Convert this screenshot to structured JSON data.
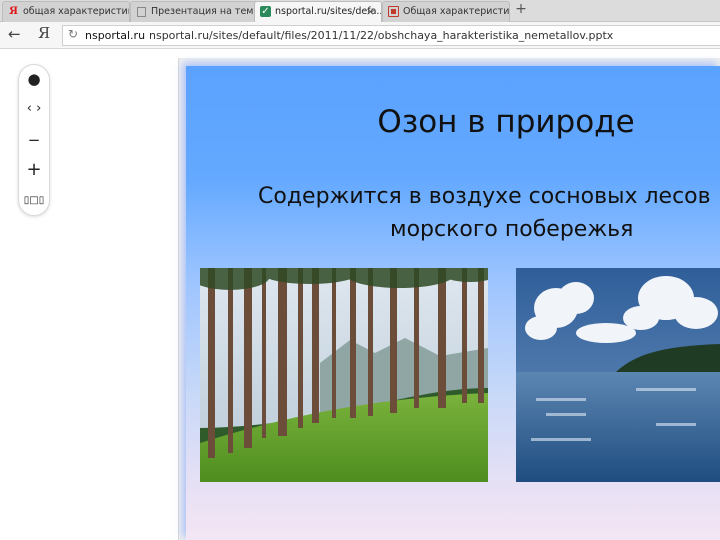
{
  "tabs": [
    {
      "label": "общая характеристика",
      "icon": "yandex-icon",
      "active": false
    },
    {
      "label": "Презентация на тему",
      "icon": "page-icon",
      "active": false
    },
    {
      "label": "nsportal.ru/sites/defa...",
      "icon": "nsportal-check-icon",
      "active": true
    },
    {
      "label": "Общая характеристика",
      "icon": "presentation-icon",
      "active": false
    }
  ],
  "toolbar": {
    "back_glyph": "←",
    "yandex_glyph": "Я",
    "reload_glyph": "↻",
    "domain": "nsportal.ru",
    "url": "nsportal.ru/sites/default/files/2011/11/22/obshchaya_harakteristika_nemetallov.pptx"
  },
  "controls": {
    "dot": "●",
    "nav": "‹ ›",
    "zoom_out": "−",
    "zoom_in": "+",
    "fit": "▯□▯"
  },
  "slide": {
    "title": "Озон в природе",
    "line1": "Содержится в воздухе сосновых лесов",
    "line2": "морского побережья",
    "images": [
      "pine-forest-photo",
      "sea-coast-photo"
    ]
  },
  "colors": {
    "slide_top": "#5aa2ff",
    "slide_bottom": "#f3e6f4"
  }
}
